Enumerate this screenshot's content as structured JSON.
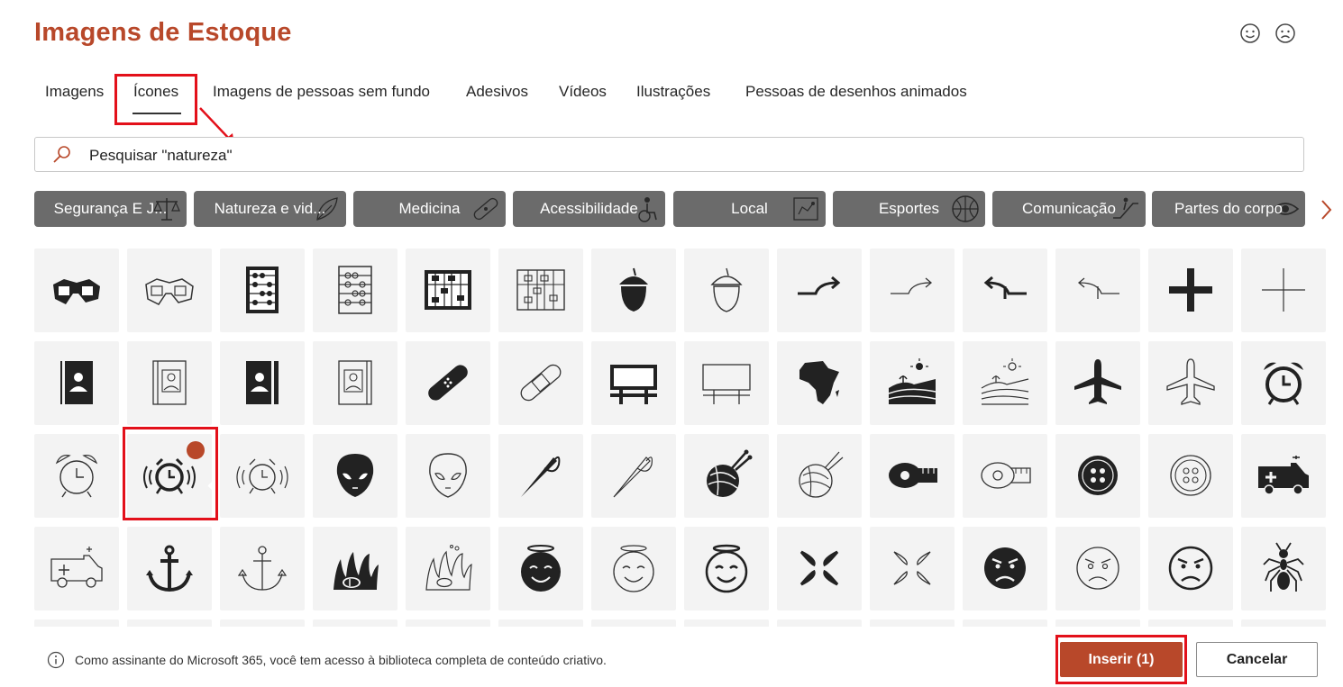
{
  "header": {
    "title": "Imagens de Estoque",
    "feedback_positive_icon": "smile-icon",
    "feedback_negative_icon": "frown-icon"
  },
  "tabs": [
    {
      "label": "Imagens"
    },
    {
      "label": "Ícones",
      "selected": true
    },
    {
      "label": "Imagens de pessoas sem fundo"
    },
    {
      "label": "Adesivos"
    },
    {
      "label": "Vídeos"
    },
    {
      "label": "Ilustrações"
    },
    {
      "label": "Pessoas de desenhos animados"
    }
  ],
  "search": {
    "placeholder": "Pesquisar \"natureza\"",
    "value": ""
  },
  "categories": [
    {
      "label": "Segurança E J...",
      "icon": "scales-icon"
    },
    {
      "label": "Natureza e vid...",
      "icon": "leaf-icon"
    },
    {
      "label": "Medicina",
      "icon": "bandage-icon"
    },
    {
      "label": "Acessibilidade",
      "icon": "accessibility-icon"
    },
    {
      "label": "Local",
      "icon": "map-icon"
    },
    {
      "label": "Esportes",
      "icon": "basketball-icon"
    },
    {
      "label": "Comunicação",
      "icon": "escalator-icon"
    },
    {
      "label": "Partes do corpo",
      "icon": "eye-icon"
    }
  ],
  "icons": [
    [
      "3d-glasses-icon",
      "3d-glasses-outline-icon",
      "abacus-icon",
      "abacus-outline-icon",
      "abacus-vertical-icon",
      "abacus-vertical-outline-icon",
      "acorn-icon",
      "acorn-outline-icon",
      "merge-right-arrow-icon",
      "merge-right-arrow-outline-icon",
      "merge-left-arrow-icon",
      "merge-left-arrow-outline-icon",
      "plus-icon",
      "plus-outline-icon"
    ],
    [
      "address-book-icon",
      "address-book-outline-icon",
      "address-book-alt-icon",
      "address-book-alt-outline-icon",
      "bandage-icon",
      "bandage-outline-icon",
      "billboard-icon",
      "billboard-outline-icon",
      "africa-icon",
      "farm-landscape-icon",
      "farm-landscape-outline-icon",
      "airplane-icon",
      "airplane-outline-icon",
      "alarm-clock-icon"
    ],
    [
      "alarm-clock-outline-icon",
      "alarm-ringing-icon",
      "alarm-ringing-outline-icon",
      "alien-face-icon",
      "alien-face-outline-icon",
      "sewing-needle-icon",
      "sewing-needle-outline-icon",
      "yarn-ball-icon",
      "yarn-ball-outline-icon",
      "measuring-tape-icon",
      "measuring-tape-outline-icon",
      "button-icon",
      "button-outline-icon",
      "ambulance-icon"
    ],
    [
      "ambulance-outline-icon",
      "anchor-icon",
      "anchor-outline-icon",
      "anemone-fish-icon",
      "anemone-fish-outline-icon",
      "angel-face-icon",
      "angel-face-outline-icon",
      "angel-face-alt-icon",
      "angry-symbol-icon",
      "angry-symbol-outline-icon",
      "angry-face-icon",
      "angry-face-outline-icon",
      "angry-face-alt-icon",
      "ant-icon"
    ]
  ],
  "selected_icon": "alarm-ringing-icon",
  "footer": {
    "info_icon": "info-icon",
    "info_text": "Como assinante do Microsoft 365, você tem acesso à biblioteca completa de conteúdo criativo.",
    "insert_label": "Inserir (1)",
    "cancel_label": "Cancelar"
  },
  "colors": {
    "accent": "#b8482a",
    "chip": "#6b6b6b",
    "tile": "#f3f3f3",
    "annotation_red": "#e3101a"
  }
}
